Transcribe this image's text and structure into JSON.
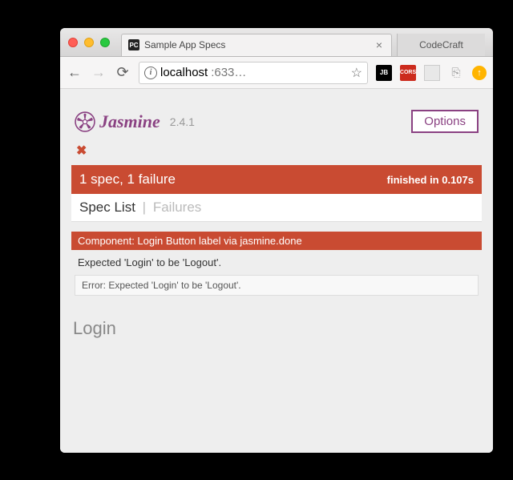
{
  "browser": {
    "tabs": [
      {
        "title": "Sample App Specs",
        "favicon": "PC"
      },
      {
        "title": "CodeCraft"
      }
    ],
    "address": {
      "host": "localhost",
      "rest": ":633…"
    }
  },
  "jasmine": {
    "name": "Jasmine",
    "version": "2.4.1",
    "options_label": "Options",
    "summary": "1 spec, 1 failure",
    "timing": "finished in 0.107s",
    "tabs": {
      "spec_list": "Spec List",
      "failures": "Failures"
    },
    "failure": {
      "title": "Component: Login Button label via jasmine.done",
      "message": "Expected 'Login' to be 'Logout'.",
      "stack": "Error: Expected 'Login' to be 'Logout'."
    }
  },
  "app": {
    "login_label": "Login"
  }
}
